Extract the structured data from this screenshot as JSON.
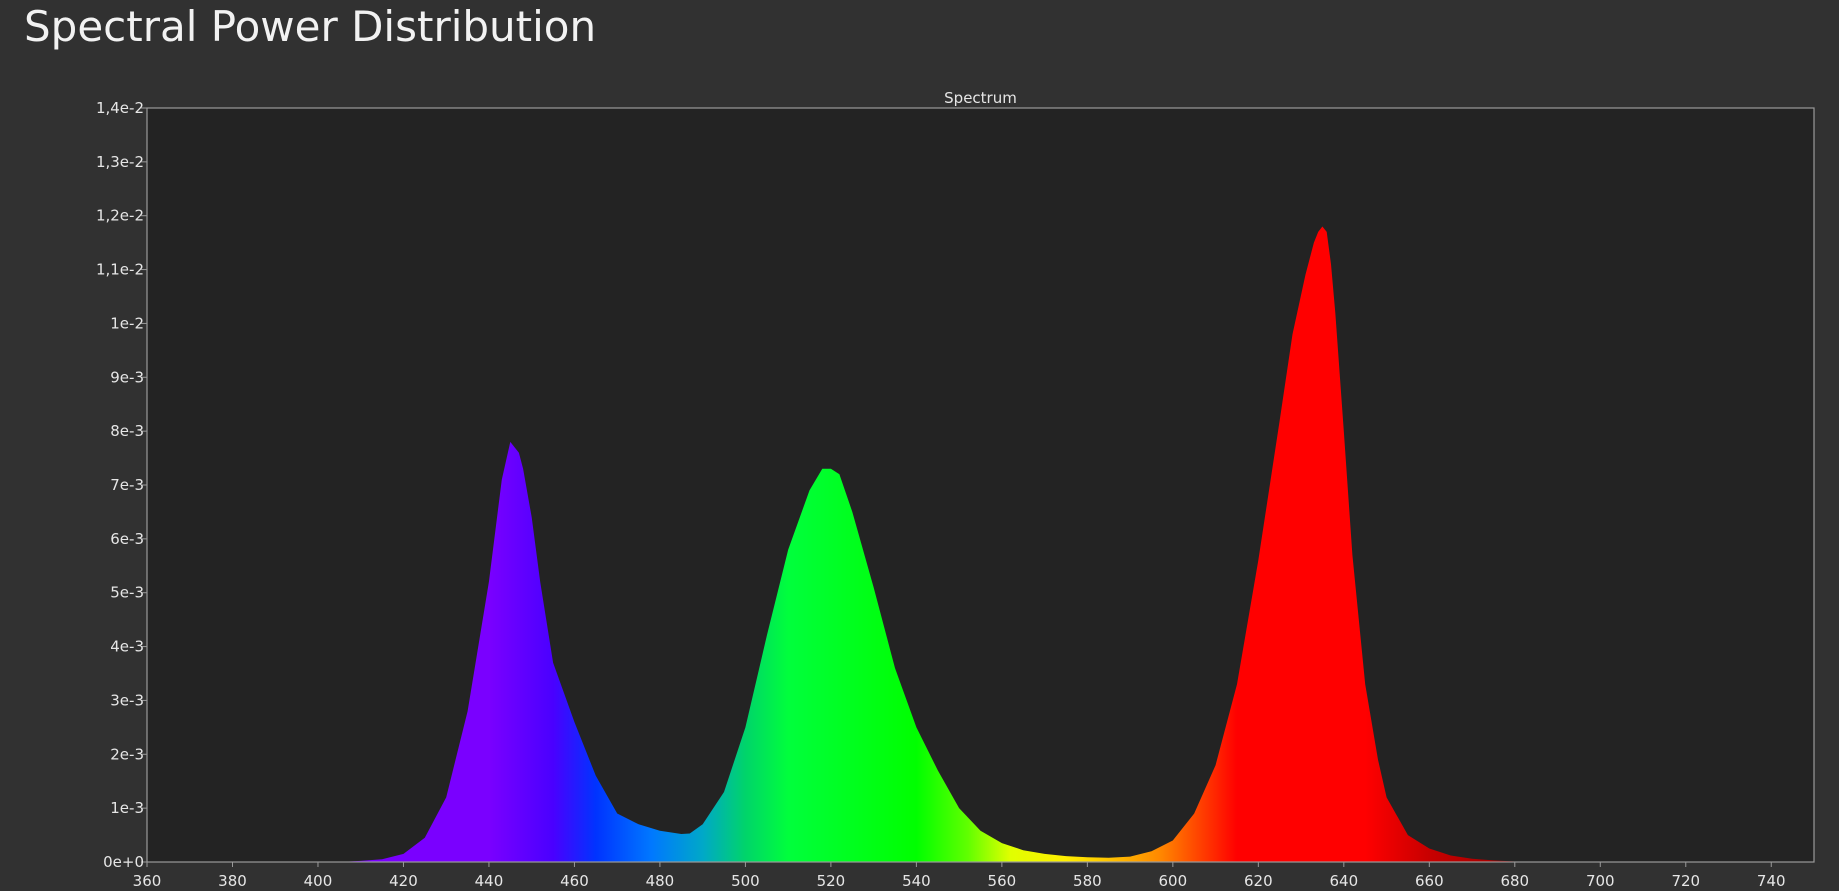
{
  "page": {
    "title": "Spectral Power Distribution"
  },
  "colors": {
    "background": "#313131",
    "plot_background": "#232323",
    "frame": "#9a9a9a",
    "text": "#e6e6e6"
  },
  "chart_data": {
    "type": "area",
    "title": "Spectrum",
    "xlabel": "",
    "ylabel": "",
    "xlim": [
      360,
      750
    ],
    "ylim": [
      0,
      0.014
    ],
    "grid": false,
    "x_ticks": [
      360,
      380,
      400,
      420,
      440,
      460,
      480,
      500,
      520,
      540,
      560,
      580,
      600,
      620,
      640,
      660,
      680,
      700,
      720,
      740
    ],
    "x_tick_labels": [
      "360",
      "380",
      "400",
      "420",
      "440",
      "460",
      "480",
      "500",
      "520",
      "540",
      "560",
      "580",
      "600",
      "620",
      "640",
      "660",
      "680",
      "700",
      "720",
      "740"
    ],
    "y_ticks": [
      0,
      0.001,
      0.002,
      0.003,
      0.004,
      0.005,
      0.006,
      0.007,
      0.008,
      0.009,
      0.01,
      0.011,
      0.012,
      0.013,
      0.014
    ],
    "y_tick_labels": [
      "0e+0",
      "1e-3",
      "2e-3",
      "3e-3",
      "4e-3",
      "5e-3",
      "6e-3",
      "7e-3",
      "8e-3",
      "9e-3",
      "1e-2",
      "1,1e-2",
      "1,2e-2",
      "1,3e-2",
      "1,4e-2"
    ],
    "series": [
      {
        "x": [
          400,
          405,
          410,
          415,
          420,
          425,
          430,
          435,
          440,
          443,
          445,
          447,
          448,
          450,
          452,
          455,
          460,
          465,
          470,
          475,
          480,
          485,
          487,
          490,
          495,
          500,
          505,
          510,
          515,
          518,
          520,
          522,
          525,
          530,
          535,
          540,
          545,
          550,
          555,
          560,
          565,
          570,
          575,
          580,
          585,
          590,
          595,
          600,
          605,
          610,
          615,
          620,
          625,
          628,
          631,
          633,
          634,
          635,
          636,
          637,
          638,
          640,
          642,
          645,
          648,
          650,
          655,
          660,
          665,
          670,
          675,
          680,
          690,
          700,
          720,
          740
        ],
        "y": [
          0.0,
          0.0,
          2e-05,
          5e-05,
          0.00015,
          0.00045,
          0.0012,
          0.0028,
          0.0052,
          0.0071,
          0.0078,
          0.0076,
          0.0073,
          0.0064,
          0.0052,
          0.0037,
          0.0026,
          0.0016,
          0.0009,
          0.0007,
          0.00058,
          0.00052,
          0.00053,
          0.0007,
          0.0013,
          0.0025,
          0.0042,
          0.0058,
          0.0069,
          0.0073,
          0.0073,
          0.0072,
          0.0065,
          0.0051,
          0.0036,
          0.0025,
          0.0017,
          0.001,
          0.00058,
          0.00035,
          0.00022,
          0.00015,
          0.00011,
          9e-05,
          8e-05,
          0.0001,
          0.0002,
          0.0004,
          0.0009,
          0.0018,
          0.0033,
          0.0056,
          0.0082,
          0.0098,
          0.0109,
          0.0115,
          0.0117,
          0.0118,
          0.0117,
          0.0111,
          0.0102,
          0.008,
          0.0057,
          0.0033,
          0.0019,
          0.0012,
          0.0005,
          0.00025,
          0.00012,
          6e-05,
          3e-05,
          1e-05,
          0.0,
          0.0,
          0.0,
          0.0
        ]
      }
    ]
  }
}
